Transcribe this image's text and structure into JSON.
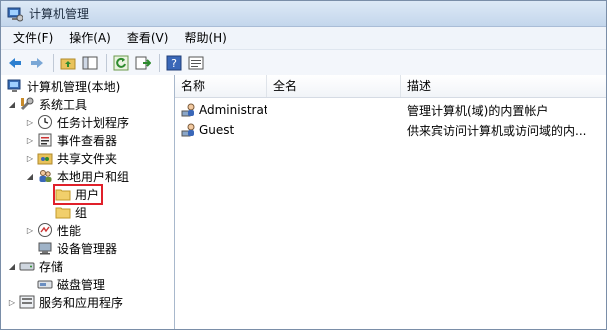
{
  "window": {
    "title": "计算机管理"
  },
  "menu": [
    {
      "label": "文件(F)"
    },
    {
      "label": "操作(A)"
    },
    {
      "label": "查看(V)"
    },
    {
      "label": "帮助(H)"
    }
  ],
  "tree": {
    "root": "计算机管理(本地)",
    "system_tools": "系统工具",
    "task_scheduler": "任务计划程序",
    "event_viewer": "事件查看器",
    "shared_folders": "共享文件夹",
    "local_users_groups": "本地用户和组",
    "users": "用户",
    "groups": "组",
    "performance": "性能",
    "device_manager": "设备管理器",
    "storage": "存储",
    "disk_management": "磁盘管理",
    "services_apps": "服务和应用程序"
  },
  "list": {
    "columns": [
      "名称",
      "全名",
      "描述"
    ],
    "rows": [
      {
        "name": "Administrat...",
        "fullname": "",
        "desc": "管理计算机(域)的内置帐户"
      },
      {
        "name": "Guest",
        "fullname": "",
        "desc": "供来宾访问计算机或访问域的内..."
      }
    ]
  },
  "colors": {
    "titlebar": "#dde9f6",
    "highlight_box": "#e0202a"
  }
}
